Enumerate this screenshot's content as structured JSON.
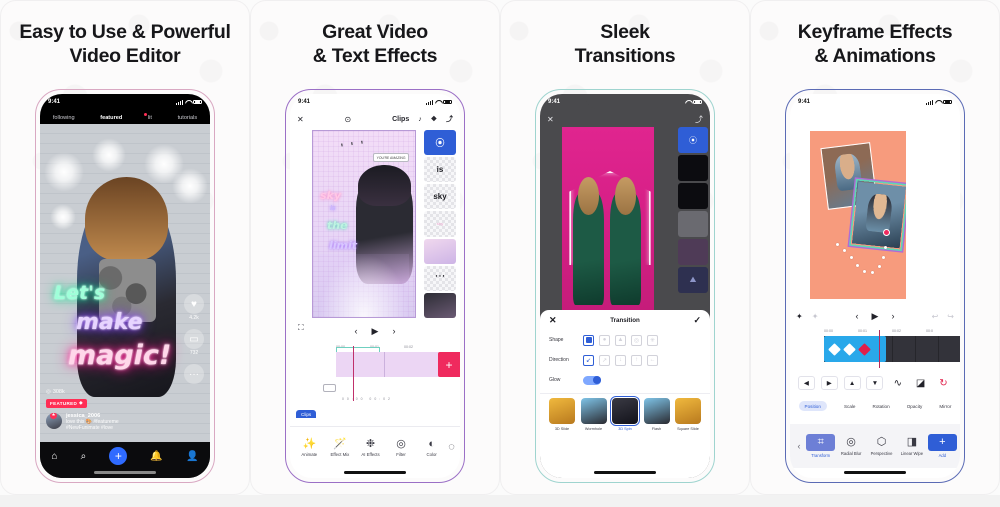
{
  "cards": [
    {
      "headline": "Easy to Use & Powerful\nVideo Editor",
      "frame_color": "#d9a8c2",
      "phone": {
        "status_time": "9:41",
        "feed_tabs": [
          {
            "label": "following",
            "active": false
          },
          {
            "label": "featured",
            "active": true
          },
          {
            "label": "lit",
            "active": false,
            "badge_dot": true
          },
          {
            "label": "tutorials",
            "active": false
          }
        ],
        "overlay_text": [
          "Let's",
          "make",
          "magic!"
        ],
        "overlay_colors": [
          "#27f0a7",
          "#9b5cff",
          "#ff0e8c"
        ],
        "like_count": "4.2k",
        "comment_count": "732",
        "views": "308k",
        "featured_badge": "FEATURED",
        "username": "jessica_2006",
        "caption_line1": "love this",
        "caption_tag1": "#featureme",
        "caption_line2": "#NewFunimate #love",
        "tabbar_icons": [
          "home-icon",
          "search-icon",
          "plus-icon",
          "bell-icon",
          "profile-icon"
        ]
      }
    },
    {
      "headline": "Great Video\n& Text Effects",
      "frame_color": "#9b6fc6",
      "phone": {
        "status_time": "9:41",
        "toolbar_title": "Clips",
        "toolbar_icons": [
          "close-icon",
          "help-icon",
          "music-icon",
          "layers-icon",
          "export-icon"
        ],
        "canvas_text": [
          "sky",
          "is",
          "the",
          "limit"
        ],
        "speech_bubble": "YOU'RE AMAZING",
        "layers": [
          {
            "label": "",
            "type": "selected-tool"
          },
          {
            "label": "is",
            "type": "text"
          },
          {
            "label": "sky",
            "type": "text"
          },
          {
            "label": "",
            "type": "faint-text"
          },
          {
            "label": "",
            "type": "image"
          },
          {
            "label": "",
            "type": "strokes"
          },
          {
            "label": "",
            "type": "photo"
          }
        ],
        "transport_icons": [
          "expand-icon",
          "prev-frame-icon",
          "play-icon",
          "next-frame-icon"
        ],
        "ruler_ticks": [
          "00:00",
          "00:01",
          "00:02"
        ],
        "clip_time": "00:00  00:02",
        "clips_pill": "Clips",
        "add_button": "+",
        "tools": [
          {
            "label": "Animate",
            "icon": "animate-icon"
          },
          {
            "label": "Effect Mix",
            "icon": "effect-mix-icon"
          },
          {
            "label": "AI Effects",
            "icon": "ai-effects-icon"
          },
          {
            "label": "Filter",
            "icon": "filter-icon"
          },
          {
            "label": "Color",
            "icon": "color-icon"
          }
        ]
      }
    },
    {
      "headline": "Sleek\nTransitions",
      "frame_color": "#9fd4cf",
      "phone": {
        "status_time": "9:41",
        "toolbar_icons": [
          "close-icon",
          "export-icon"
        ],
        "sheet_title": "Transition",
        "sheet_close_icon": "close-icon",
        "sheet_confirm_icon": "check-icon",
        "rows": [
          {
            "label": "Shape",
            "options": 5,
            "selected": 0
          },
          {
            "label": "Direction",
            "options": 5,
            "selected": 0
          }
        ],
        "glow_label": "Glow",
        "glow_on": true,
        "transitions": [
          {
            "name": "3D Slide",
            "active": false
          },
          {
            "name": "Wormhole",
            "active": false
          },
          {
            "name": "3D Spin",
            "active": true
          },
          {
            "name": "Flash",
            "active": false
          },
          {
            "name": "Square Slide",
            "active": false
          }
        ]
      }
    },
    {
      "headline": "Keyframe Effects\n& Animations",
      "frame_color": "#5b6bb5",
      "phone": {
        "status_time": "9:41",
        "transport_icons": [
          "keyframe-icon",
          "keyframe-dim-icon",
          "prev-frame-icon",
          "play-icon",
          "next-frame-icon",
          "undo-icon",
          "redo-icon"
        ],
        "ruler_ticks": [
          "00:00",
          "00:01",
          "00:02",
          "00:0"
        ],
        "arrow_buttons": [
          "arrow-left-icon",
          "arrow-right-icon",
          "arrow-up-icon",
          "arrow-down-icon",
          "curve-icon",
          "linear-icon",
          "reset-icon"
        ],
        "property_tabs": [
          {
            "label": "Position",
            "active": true
          },
          {
            "label": "Scale",
            "active": false
          },
          {
            "label": "Rotation",
            "active": false
          },
          {
            "label": "Opacity",
            "active": false
          },
          {
            "label": "Mirror",
            "active": false
          }
        ],
        "effects": [
          {
            "label": "Transform",
            "icon": "transform-icon",
            "state": "selected"
          },
          {
            "label": "Radial Blur",
            "icon": "radial-blur-icon",
            "state": "normal"
          },
          {
            "label": "Perspective",
            "icon": "perspective-icon",
            "state": "normal"
          },
          {
            "label": "Linear Wipe",
            "icon": "linear-wipe-icon",
            "state": "normal"
          },
          {
            "label": "Add",
            "icon": "add-icon",
            "state": "add"
          }
        ]
      }
    }
  ]
}
